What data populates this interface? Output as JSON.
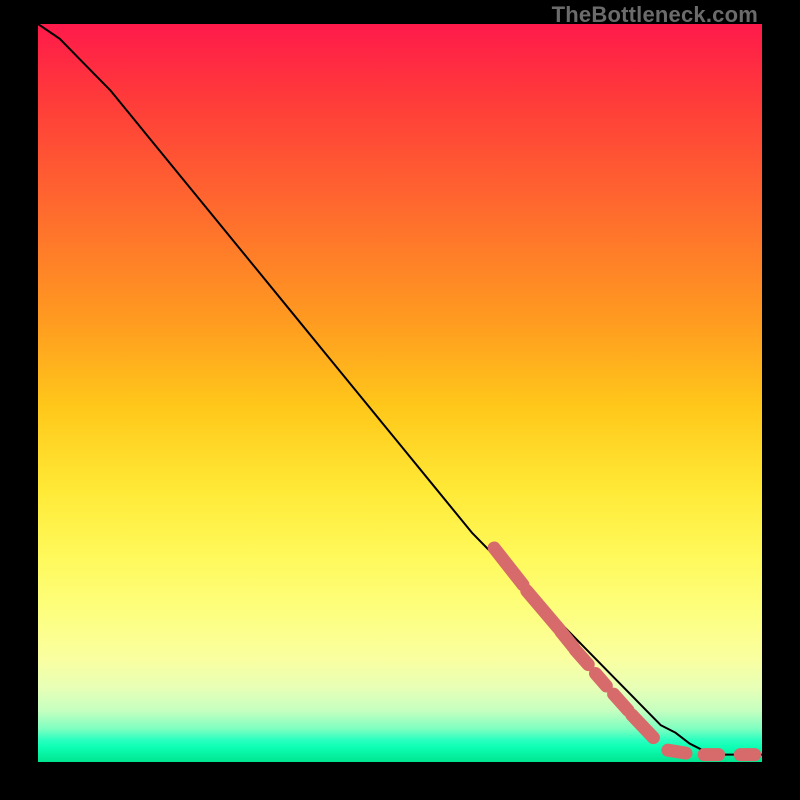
{
  "watermark": "TheBottleneck.com",
  "colors": {
    "background": "#000000",
    "curve": "#000000",
    "dash": "#d76a6a",
    "watermark": "#6b6b6b"
  },
  "chart_data": {
    "type": "line",
    "title": "",
    "xlabel": "",
    "ylabel": "",
    "xlim": [
      0,
      100
    ],
    "ylim": [
      0,
      100
    ],
    "series": [
      {
        "name": "bottleneck-curve",
        "x": [
          0,
          3,
          6,
          10,
          15,
          20,
          25,
          30,
          35,
          40,
          45,
          50,
          55,
          60,
          64,
          68,
          72,
          76,
          80,
          83,
          86,
          88,
          90,
          92,
          94,
          96,
          98,
          100
        ],
        "y": [
          100,
          98,
          95,
          91,
          85,
          79,
          73,
          67,
          61,
          55,
          49,
          43,
          37,
          31,
          27,
          23,
          19,
          15,
          11,
          8,
          5,
          4,
          2.5,
          1.5,
          1,
          1,
          1,
          1
        ]
      }
    ],
    "dash_overlay": {
      "note": "Thick salmon dashed overlay along the lower-right portion of the curve",
      "segments_xy": [
        {
          "x0": 63,
          "y0": 29,
          "x1": 67,
          "y1": 24
        },
        {
          "x0": 67.5,
          "y0": 23.2,
          "x1": 72,
          "y1": 18
        },
        {
          "x0": 72.2,
          "y0": 17.7,
          "x1": 74,
          "y1": 15.5
        },
        {
          "x0": 74.2,
          "y0": 15.2,
          "x1": 76,
          "y1": 13.2
        },
        {
          "x0": 77,
          "y0": 12,
          "x1": 78.5,
          "y1": 10.3
        },
        {
          "x0": 79.5,
          "y0": 9.2,
          "x1": 81.5,
          "y1": 7
        },
        {
          "x0": 82,
          "y0": 6.4,
          "x1": 85,
          "y1": 3.3
        },
        {
          "x0": 87,
          "y0": 1.6,
          "x1": 89.5,
          "y1": 1.2
        },
        {
          "x0": 92,
          "y0": 1,
          "x1": 94,
          "y1": 1
        },
        {
          "x0": 97,
          "y0": 1,
          "x1": 99,
          "y1": 1
        }
      ]
    }
  }
}
